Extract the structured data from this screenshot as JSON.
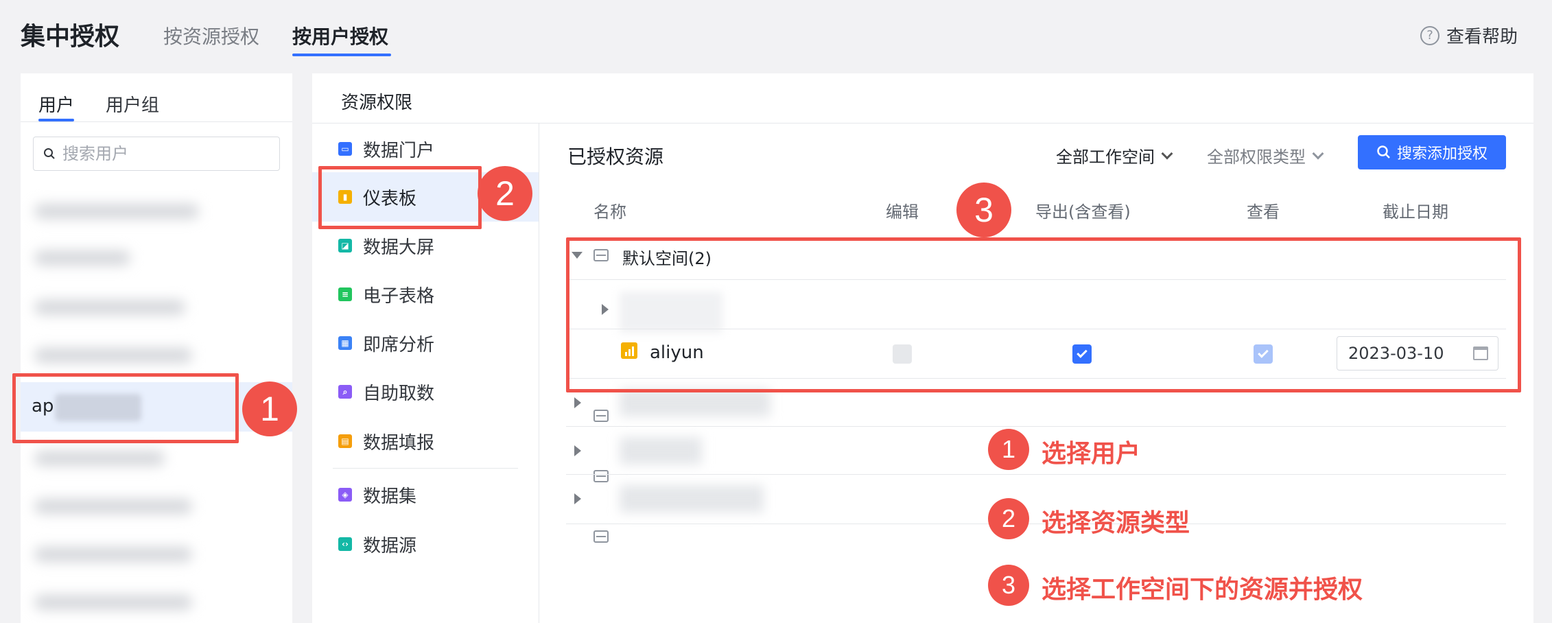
{
  "header": {
    "title": "集中授权",
    "tabs": [
      {
        "label": "按资源授权",
        "active": false
      },
      {
        "label": "按用户授权",
        "active": true
      }
    ],
    "help_label": "查看帮助",
    "help_icon": "?"
  },
  "users_panel": {
    "tabs": [
      {
        "label": "用户",
        "active": true
      },
      {
        "label": "用户组",
        "active": false
      }
    ],
    "search_placeholder": "搜索用户",
    "selected_user_prefix": "ap"
  },
  "main": {
    "panel_title": "资源权限",
    "resource_types": [
      {
        "label": "数据门户",
        "icon": "portal-icon",
        "color": "#3370ff"
      },
      {
        "label": "仪表板",
        "icon": "dashboard-icon",
        "color": "#f5b000",
        "active": true
      },
      {
        "label": "数据大屏",
        "icon": "screen-icon",
        "color": "#14b8a6"
      },
      {
        "label": "电子表格",
        "icon": "spreadsheet-icon",
        "color": "#22c55e"
      },
      {
        "label": "即席分析",
        "icon": "adhoc-icon",
        "color": "#3b82f6"
      },
      {
        "label": "自助取数",
        "icon": "self-service-icon",
        "color": "#8b5cf6"
      },
      {
        "label": "数据填报",
        "icon": "form-icon",
        "color": "#f59e0b"
      },
      {
        "label": "数据集",
        "icon": "dataset-icon",
        "color": "#8b5cf6"
      },
      {
        "label": "数据源",
        "icon": "datasource-icon",
        "color": "#14b8a6"
      }
    ],
    "authorized_title": "已授权资源",
    "filters": {
      "workspace": "全部工作空间",
      "permission_type": "全部权限类型"
    },
    "search_add_button": "搜索添加授权",
    "table": {
      "headers": [
        "名称",
        "编辑",
        "导出(含查看)",
        "查看",
        "截止日期"
      ],
      "workspace_row": "默认空间(2)",
      "resource_row": {
        "name": "aliyun",
        "edit": "disabled",
        "export": "checked",
        "view": "checked-disabled",
        "deadline": "2023-03-10"
      }
    }
  },
  "annotations": {
    "markers": [
      "1",
      "2",
      "3"
    ],
    "legend": [
      {
        "num": "1",
        "text": "选择用户"
      },
      {
        "num": "2",
        "text": "选择资源类型"
      },
      {
        "num": "3",
        "text": "选择工作空间下的资源并授权"
      }
    ],
    "accent_color": "#f0524a"
  },
  "colors": {
    "primary": "#3370ff",
    "selected_bg": "#e9f0fd",
    "page_bg": "#f2f2f4"
  }
}
